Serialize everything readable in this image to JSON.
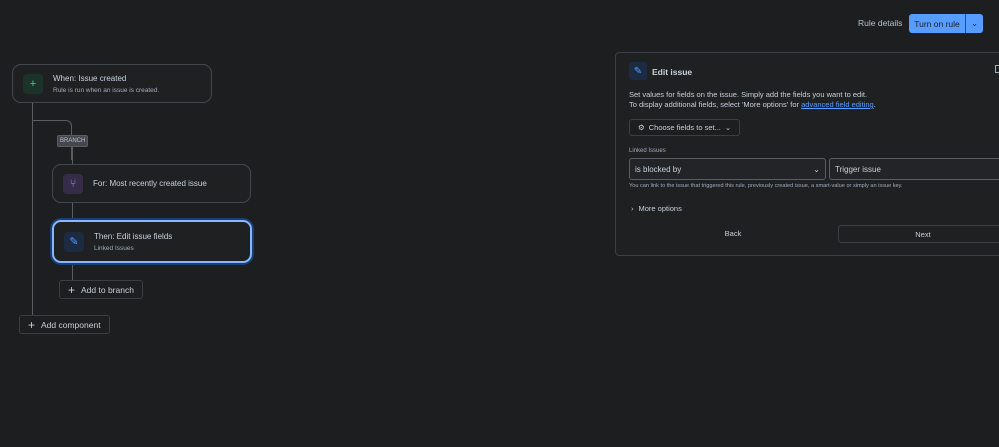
{
  "header": {
    "rule_details": "Rule details",
    "turn_on": "Turn on rule"
  },
  "flow": {
    "trigger": {
      "title": "When: Issue created",
      "subtitle": "Rule is run when an issue is created."
    },
    "branch_tag": "BRANCH",
    "for_node": {
      "title": "For: Most recently created issue"
    },
    "then_node": {
      "title": "Then: Edit issue fields",
      "subtitle": "Linked Issues"
    },
    "add_to_branch": "Add to branch",
    "add_component": "Add component"
  },
  "panel": {
    "title": "Edit issue",
    "desc1": "Set values for fields on the issue. Simply add the fields you want to edit.",
    "desc2": "To display additional fields, select 'More options' for ",
    "desc_link": "advanced field editing",
    "desc_end": ".",
    "choose_fields": "Choose fields to set...",
    "field_label": "Linked Issues",
    "link_type": "is blocked by",
    "issue_value": "Trigger issue",
    "help": "You can link to the issue that triggered this rule, previously created issue, a smart-value or simply an issue key.",
    "more_options": "More options",
    "back": "Back",
    "next": "Next"
  },
  "colors": {
    "accent": "#579dff",
    "bg": "#1d1e20"
  }
}
